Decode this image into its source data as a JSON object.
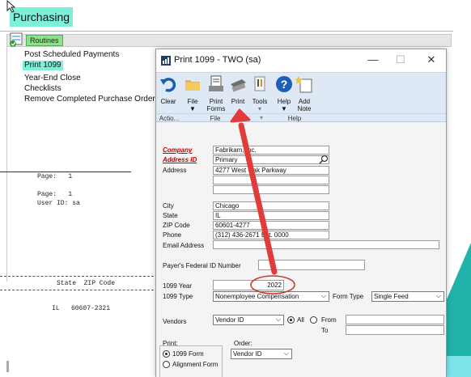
{
  "app": {
    "module_title": "Purchasing",
    "section_tab": "Routines"
  },
  "routines": [
    "Post Scheduled Payments",
    "Print 1099",
    "Year-End Close",
    "Checklists",
    "Remove Completed Purchase Orders"
  ],
  "report": {
    "page_label1": "Page:   1",
    "page_label2": "Page:   1",
    "user_id": "User ID: sa",
    "col_header": "State  ZIP Code",
    "row": "IL   60607-2321"
  },
  "dialog": {
    "title": "Print 1099  -  TWO (sa)",
    "controls": {
      "minimize": "—",
      "maximize": "☐",
      "close": "✕"
    },
    "ribbon": {
      "buttons": [
        "Clear",
        "File",
        "Print Forms",
        "Print",
        "Tools",
        "Help",
        "Add Note"
      ],
      "groups": [
        "Actio...",
        "File",
        "",
        "Help"
      ]
    },
    "fields": {
      "company_label": "Company",
      "company_value": "Fabrikam, Inc.",
      "address_id_label": "Address ID",
      "address_id_value": "Primary",
      "address_label": "Address",
      "address_value": "4277 West Oak Parkway",
      "city_label": "City",
      "city_value": "Chicago",
      "state_label": "State",
      "state_value": "IL",
      "zip_label": "ZIP Code",
      "zip_value": "60601-4277",
      "phone_label": "Phone",
      "phone_value": "(312) 436-2671  Ext. 0000",
      "email_label": "Email Address",
      "email_value": "",
      "fed_id_label": "Payer's Federal ID Number",
      "fed_id_value": "",
      "year_label": "1099 Year",
      "year_value": "2022",
      "type_label": "1099 Type",
      "type_value": "Nonemployee Compensation",
      "form_type_label": "Form Type",
      "form_type_value": "Single Feed",
      "vendors_label": "Vendors",
      "vendors_value": "Vendor ID",
      "all_label": "All",
      "from_label": "From",
      "to_label": "To",
      "print_label": "Print:",
      "order_label": "Order:",
      "order_value": "Vendor ID",
      "opt_1099": "1099 Form",
      "opt_align": "Alignment Form"
    }
  },
  "colors": {
    "selection": "#7ef0d9",
    "arrow": "#e23b3b",
    "teal": "#21b3ab"
  }
}
